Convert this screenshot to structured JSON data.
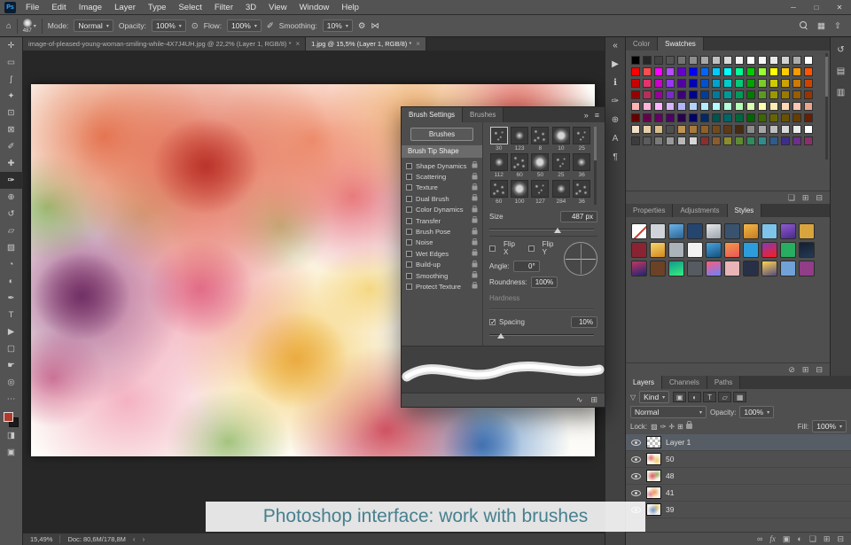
{
  "menubar": {
    "logo": "Ps",
    "items": [
      "File",
      "Edit",
      "Image",
      "Layer",
      "Type",
      "Select",
      "Filter",
      "3D",
      "View",
      "Window",
      "Help"
    ]
  },
  "window_controls": [
    {
      "name": "minimize",
      "glyph": "─"
    },
    {
      "name": "maximize",
      "glyph": "□"
    },
    {
      "name": "close",
      "glyph": "✕"
    }
  ],
  "options": {
    "home_icon": "⌂",
    "brush_size": "487",
    "mode_label": "Mode:",
    "mode_value": "Normal",
    "opacity_label": "Opacity:",
    "opacity_value": "100%",
    "flow_label": "Flow:",
    "flow_value": "100%",
    "smoothing_label": "Smoothing:",
    "smoothing_value": "10%"
  },
  "options_icons": [
    {
      "name": "pressure-opacity",
      "glyph": "⊙"
    },
    {
      "name": "airbrush",
      "glyph": "✐"
    },
    {
      "name": "smoothing-gear",
      "glyph": "⚙"
    },
    {
      "name": "paint-symmetry",
      "glyph": "⋈"
    }
  ],
  "options_right_icons": [
    {
      "name": "workspace-switcher",
      "glyph": "▦"
    },
    {
      "name": "share-image",
      "glyph": "⇧"
    }
  ],
  "doc_tabs": [
    {
      "label": "image-of-pleased-young-woman-smiling-while-4X7J4UH.jpg @ 22,2% (Layer 1, RGB/8) *",
      "active": false
    },
    {
      "label": "1.jpg @ 15,5% (Layer 1, RGB/8) *",
      "active": true
    }
  ],
  "toolbar": {
    "foreground_color": "#b03a2e",
    "background_color": "#1a1a1a",
    "tools": [
      {
        "name": "move",
        "glyph": "✛"
      },
      {
        "name": "marquee",
        "glyph": "▭"
      },
      {
        "name": "lasso",
        "glyph": "ʃ"
      },
      {
        "name": "quick-selection",
        "glyph": "✦"
      },
      {
        "name": "crop",
        "glyph": "⊡"
      },
      {
        "name": "frame",
        "glyph": "⊠"
      },
      {
        "name": "eyedropper",
        "glyph": "✐"
      },
      {
        "name": "spot-healing",
        "glyph": "✚"
      },
      {
        "name": "brush",
        "glyph": "✑",
        "selected": true
      },
      {
        "name": "clone-stamp",
        "glyph": "⊕"
      },
      {
        "name": "history-brush",
        "glyph": "↺"
      },
      {
        "name": "eraser",
        "glyph": "▱"
      },
      {
        "name": "gradient",
        "glyph": "▨"
      },
      {
        "name": "blur",
        "glyph": "◔"
      },
      {
        "name": "dodge",
        "glyph": "◐"
      },
      {
        "name": "pen",
        "glyph": "✒"
      },
      {
        "name": "type",
        "glyph": "T"
      },
      {
        "name": "path-selection",
        "glyph": "▶"
      },
      {
        "name": "shape",
        "glyph": "▢"
      },
      {
        "name": "hand",
        "glyph": "☛"
      },
      {
        "name": "zoom",
        "glyph": "◎"
      },
      {
        "name": "edit-toolbar",
        "glyph": "⋯"
      }
    ],
    "bottom_icons": [
      {
        "name": "quick-mask",
        "glyph": "◨"
      },
      {
        "name": "screen-mode",
        "glyph": "▣"
      }
    ]
  },
  "left_dock": [
    {
      "name": "collapse-panels",
      "glyph": "«"
    },
    {
      "name": "actions-panel",
      "glyph": "▶"
    },
    {
      "name": "info-panel",
      "glyph": "ℹ"
    },
    {
      "name": "brush-settings-panel",
      "glyph": "✑"
    },
    {
      "name": "clone-source-panel",
      "glyph": "⊕"
    },
    {
      "name": "character-panel",
      "glyph": "A"
    },
    {
      "name": "paragraph-panel",
      "glyph": "¶"
    }
  ],
  "right_dock": [
    {
      "name": "history-panel",
      "glyph": "↺"
    },
    {
      "name": "navigator-panel",
      "glyph": "▤"
    },
    {
      "name": "libraries-panel",
      "glyph": "▥"
    }
  ],
  "brush_panel": {
    "tabs": [
      "Brush Settings",
      "Brushes"
    ],
    "active_tab": 0,
    "header_icons": [
      {
        "name": "expand-panel",
        "glyph": "»"
      },
      {
        "name": "panel-menu",
        "glyph": "≡"
      }
    ],
    "brushes_button": "Brushes",
    "tip_shape_label": "Brush Tip Shape",
    "options": [
      "Shape Dynamics",
      "Scattering",
      "Texture",
      "Dual Brush",
      "Color Dynamics",
      "Transfer",
      "Brush Pose",
      "Noise",
      "Wet Edges",
      "Build-up",
      "Smoothing",
      "Protect Texture"
    ],
    "thumb_sizes": [
      [
        "30",
        "123",
        "8",
        "10",
        "25"
      ],
      [
        "112",
        "60",
        "50",
        "25",
        "36"
      ],
      [
        "60",
        "100",
        "127",
        "284",
        "36"
      ]
    ],
    "size_label": "Size",
    "size_value": "487 px",
    "flip_x_label": "Flip X",
    "flip_y_label": "Flip Y",
    "angle_label": "Angle:",
    "angle_value": "0°",
    "roundness_label": "Roundness:",
    "roundness_value": "100%",
    "hardness_label": "Hardness",
    "spacing_label": "Spacing",
    "spacing_value": "10%",
    "footer_icons": [
      {
        "name": "stroke-preview-toggle",
        "glyph": "∿"
      },
      {
        "name": "new-brush",
        "glyph": "⊞"
      }
    ]
  },
  "swatches_panel": {
    "tabs": [
      "Color",
      "Swatches"
    ],
    "active_tab": 1,
    "rows": [
      [
        "#000000",
        "#262626",
        "#434343",
        "#555555",
        "#737373",
        "#8d8d8d",
        "#a6a6a6",
        "#bfbfbf",
        "#d9d9d9",
        "#f2f2f2",
        "#ffffff",
        "#f7f7f7",
        "#e8e8e8",
        "#d1d1d1",
        "#ababab",
        "#ffffff"
      ],
      [
        "#ff0000",
        "#ff4d4d",
        "#ff00ff",
        "#b34dff",
        "#6600cc",
        "#0000ff",
        "#0066ff",
        "#00ccff",
        "#00ffff",
        "#00ff99",
        "#00cc00",
        "#99ff33",
        "#ffff00",
        "#ffcc00",
        "#ff9900",
        "#ff5500"
      ],
      [
        "#cc0000",
        "#e8326d",
        "#cc00cc",
        "#9933ff",
        "#5200a3",
        "#0000b8",
        "#0052cc",
        "#00a3cc",
        "#00cccc",
        "#00cc7a",
        "#00a300",
        "#7acc29",
        "#cccc00",
        "#cca300",
        "#cc7a00",
        "#cc4400"
      ],
      [
        "#990000",
        "#b82e59",
        "#990099",
        "#7a29cc",
        "#3d007a",
        "#00008f",
        "#003d99",
        "#007a99",
        "#009999",
        "#00995c",
        "#007a00",
        "#5c9921",
        "#999900",
        "#997a00",
        "#995c00",
        "#993300"
      ],
      [
        "#ffb3b3",
        "#ffb3d9",
        "#ffb3ff",
        "#d9b3ff",
        "#b3b3ff",
        "#b3d1ff",
        "#b3ecff",
        "#b3ffff",
        "#b3ffd9",
        "#b3ffb3",
        "#d9ffb3",
        "#ffffb3",
        "#ffecb3",
        "#ffd9b3",
        "#ffc6b3",
        "#e8a58c"
      ],
      [
        "#660000",
        "#66004d",
        "#660066",
        "#4d0066",
        "#29004d",
        "#000066",
        "#002966",
        "#00524d",
        "#006666",
        "#00663d",
        "#006600",
        "#3d6600",
        "#666600",
        "#665200",
        "#663d00",
        "#661f00"
      ],
      [
        "#f2e0c8",
        "#e6cfa8",
        "#d9bc8a",
        "#ccа86e",
        "#bf9455",
        "#a87a3d",
        "#8f6029",
        "#734a1d",
        "#5c3a17",
        "#452b11",
        "#8c8c8c",
        "#a6a6a6",
        "#bfbfbf",
        "#d9d9d9",
        "#ebebeb",
        "#ffffff"
      ],
      [
        "#3d3d3d",
        "#5c5c5c",
        "#7a7a7a",
        "#999999",
        "#b8b8b8",
        "#d6d6d6",
        "#8c2e2e",
        "#8c5c2e",
        "#8c8c2e",
        "#5c8c2e",
        "#2e8c5c",
        "#2e8c8c",
        "#2e5c8c",
        "#3d2e8c",
        "#6e2e8c",
        "#8c2e6e"
      ]
    ],
    "bottom_icons": [
      {
        "name": "new-swatch-group",
        "glyph": "❏"
      },
      {
        "name": "new-swatch",
        "glyph": "⊞"
      },
      {
        "name": "delete-swatch",
        "glyph": "⊟"
      }
    ]
  },
  "styles_panel": {
    "tabs": [
      "Properties",
      "Adjustments",
      "Styles"
    ],
    "active_tab": 2,
    "items": [
      "none",
      "#cfd4da",
      "g:#6db3e8,#2a6496",
      "#24456e",
      "g:#e8e8e8,#9aa4ae",
      "#39536f",
      "g:#f2b84b,#c97c1e",
      "#7ec3ea",
      "g:#8e5bd1,#4a2a8a",
      "#d8a43e",
      "#8a2433",
      "g:#f5d76e,#d4881e",
      "#aab2ba",
      "#f2f2f2",
      "g:#4aa3df,#15527e",
      "g:#f2994a,#eb5757",
      "#2d9cdb",
      "g:#833ab4,#fd1d1d",
      "#27ae60",
      "g:#141e30,#243b55",
      "g:#c33764,#1d2671",
      "#6b4226",
      "g:#11998e,#38ef7d",
      "#555b61",
      "g:#fc5c7d,#6a82fb",
      "#e8b4b8",
      "#283048",
      "g:#ffd452,#544a7d",
      "#70a1d7",
      "#913d88"
    ],
    "bottom_icons": [
      {
        "name": "clear-style",
        "glyph": "⊘"
      },
      {
        "name": "new-style",
        "glyph": "⊞"
      },
      {
        "name": "delete-style",
        "glyph": "⊟"
      }
    ]
  },
  "layers_panel": {
    "tabs": [
      "Layers",
      "Channels",
      "Paths"
    ],
    "active_tab": 0,
    "filter_label": "Kind",
    "filter_icons": [
      {
        "name": "filter-pixel-layers",
        "glyph": "▣"
      },
      {
        "name": "filter-adjustment-layers",
        "glyph": "◐"
      },
      {
        "name": "filter-type-layers",
        "glyph": "T"
      },
      {
        "name": "filter-shape-layers",
        "glyph": "▱"
      },
      {
        "name": "filter-smart-objects",
        "glyph": "▦"
      }
    ],
    "blend_mode": "Normal",
    "opacity_label": "Opacity:",
    "opacity_value": "100%",
    "lock_label": "Lock:",
    "lock_icons": [
      {
        "name": "lock-transparency",
        "glyph": "▨"
      },
      {
        "name": "lock-pixels",
        "glyph": "✑"
      },
      {
        "name": "lock-position",
        "glyph": "✛"
      },
      {
        "name": "lock-artboard",
        "glyph": "⊞"
      },
      {
        "name": "lock-all",
        "glyph": "LOCK"
      }
    ],
    "fill_label": "Fill:",
    "fill_value": "100%",
    "layers": [
      {
        "name": "Layer 1",
        "thumb": "checker",
        "selected": true
      },
      {
        "name": "50",
        "thumb": "f1",
        "selected": false
      },
      {
        "name": "48",
        "thumb": "f2",
        "selected": false
      },
      {
        "name": "41",
        "thumb": "f3",
        "selected": false
      },
      {
        "name": "39",
        "thumb": "f4",
        "selected": false
      }
    ],
    "bottom_icons": [
      {
        "name": "link-layers",
        "glyph": "∞"
      },
      {
        "name": "layer-effects",
        "glyph": "fx"
      },
      {
        "name": "add-layer-mask",
        "glyph": "▣"
      },
      {
        "name": "new-adjustment-layer",
        "glyph": "◐"
      },
      {
        "name": "new-group",
        "glyph": "❏"
      },
      {
        "name": "new-layer",
        "glyph": "⊞"
      },
      {
        "name": "delete-layer",
        "glyph": "⊟"
      }
    ]
  },
  "statusbar": {
    "zoom": "15,49%",
    "doc_info": "Doc: 80,6M/178,8M"
  },
  "caption": {
    "text": "Photoshop interface: work with brushes",
    "color": "#47808f"
  }
}
